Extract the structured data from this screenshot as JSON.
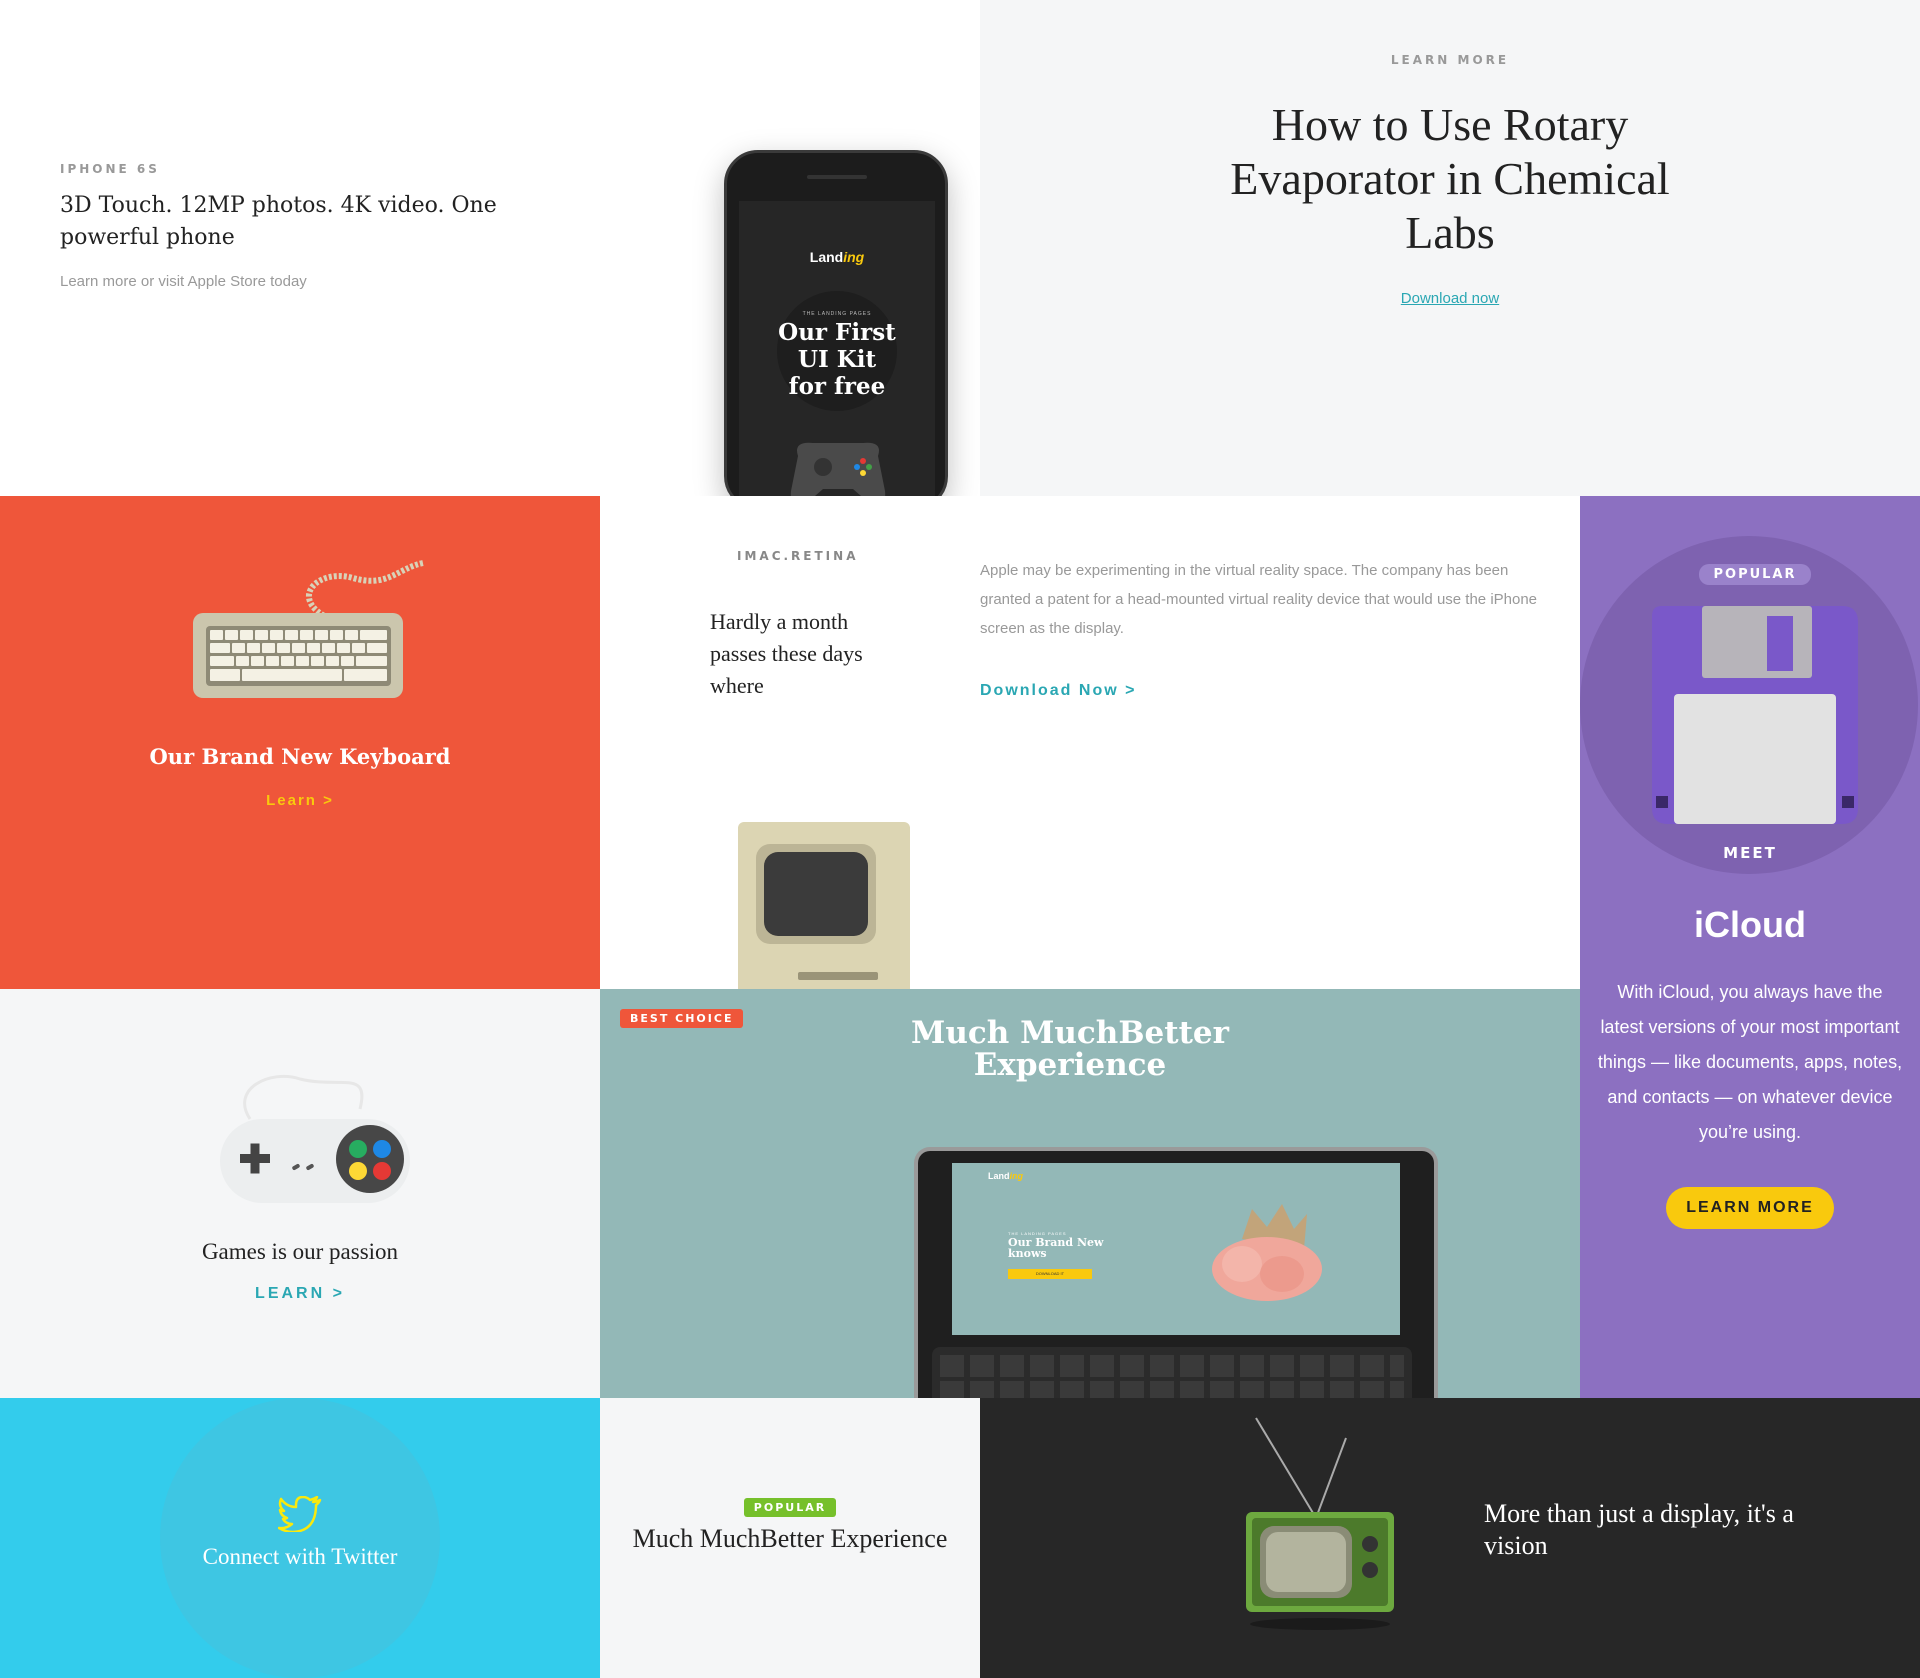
{
  "iphone": {
    "eyebrow": "IPHONE 6S",
    "title": "3D Touch. 12MP photos. 4K video. One powerful phone",
    "subtitle": "Learn more or visit Apple Store today",
    "screen": {
      "brand_prefix": "Land",
      "brand_suffix": "ing",
      "tagline": "THE LANDING PAGES",
      "headline_1": "Our First",
      "headline_2": "UI Kit",
      "headline_3": "for free"
    }
  },
  "rotary": {
    "eyebrow": "LEARN MORE",
    "title": "How to Use Rotary Evaporator in Chemical Labs",
    "link": "Download now"
  },
  "keyboard": {
    "title": "Our Brand New Keyboard",
    "link": "Learn >"
  },
  "imac": {
    "eyebrow": "IMAC.RETINA",
    "title": "Hardly a month passes these days where",
    "body": "Apple may be experimenting in the virtual reality space. The company has been granted a patent for a head-mounted virtual reality device that would use the iPhone screen as the display.",
    "link": "Download Now >"
  },
  "icloud": {
    "badge": "POPULAR",
    "eyebrow": "MEET",
    "title": "iCloud",
    "body": "With iCloud, you always have the latest versions of your most important things — like documents, apps, notes, and contacts — on whatever device you’re using.",
    "button": "LEARN MORE"
  },
  "games": {
    "title": "Games is our passion",
    "link": "LEARN >"
  },
  "best": {
    "badge": "BEST CHOICE",
    "title": "Much MuchBetter Experience",
    "screen": {
      "brand_prefix": "Land",
      "brand_suffix": "ing",
      "tagline": "THE LANDING PAGES",
      "headline": "Our Brand New knows",
      "button": "DOWNLOAD IT"
    }
  },
  "twitter": {
    "title": "Connect with Twitter"
  },
  "popular": {
    "badge": "POPULAR",
    "title": "Much MuchBetter Experience"
  },
  "tv": {
    "title": "More than just a display, it's a vision"
  },
  "colors": {
    "teal": "#2aa7b3",
    "orange": "#ef563a",
    "purple": "#8c70c1",
    "yellow": "#f9c90d",
    "green": "#76c02b",
    "twitter": "#33ccec",
    "dark": "#272727"
  }
}
